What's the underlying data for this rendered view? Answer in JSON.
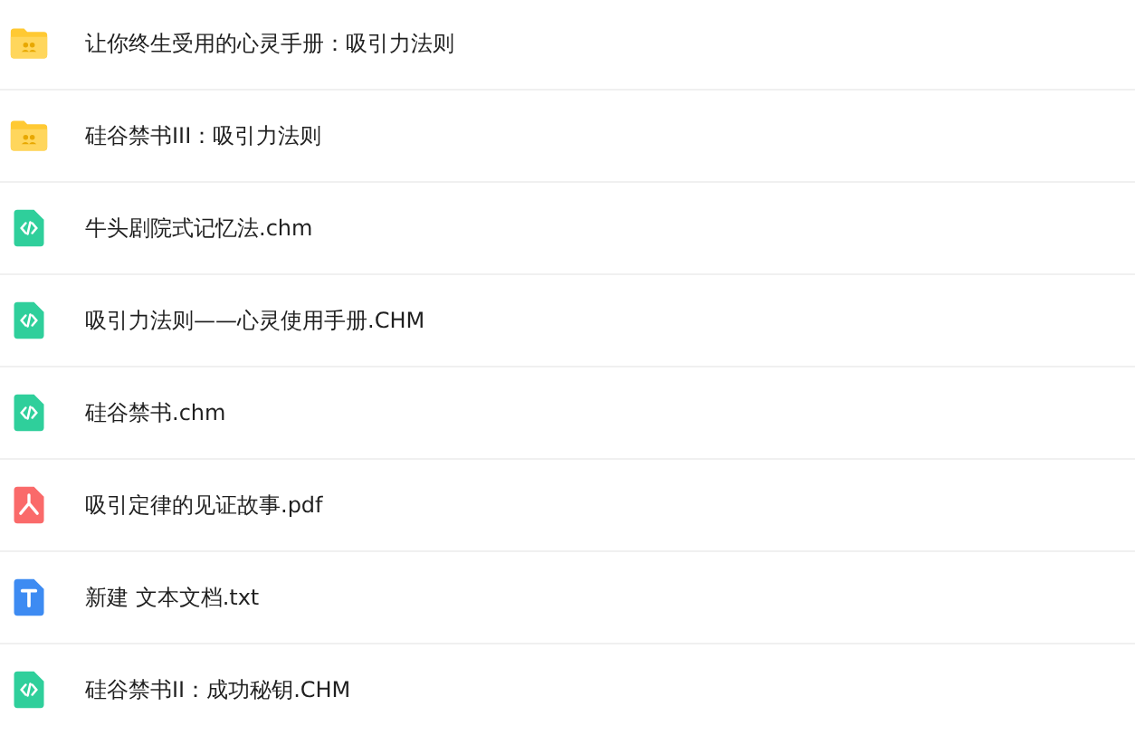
{
  "files": [
    {
      "kind": "folder",
      "name": "让你终生受用的心灵手册：吸引力法则"
    },
    {
      "kind": "folder",
      "name": "硅谷禁书III：吸引力法则"
    },
    {
      "kind": "code",
      "name": "牛头剧院式记忆法.chm"
    },
    {
      "kind": "code",
      "name": "吸引力法则——心灵使用手册.CHM"
    },
    {
      "kind": "code",
      "name": "硅谷禁书.chm"
    },
    {
      "kind": "pdf",
      "name": "吸引定律的见证故事.pdf"
    },
    {
      "kind": "text",
      "name": "新建 文本文档.txt"
    },
    {
      "kind": "code",
      "name": "硅谷禁书II：成功秘钥.CHM"
    }
  ]
}
